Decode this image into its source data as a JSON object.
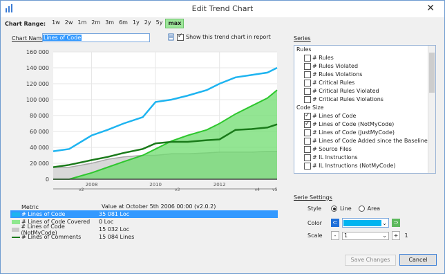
{
  "window": {
    "title": "Edit Trend Chart",
    "close_glyph": "✕"
  },
  "range": {
    "label": "Chart Range:",
    "options": [
      "1w",
      "2w",
      "1m",
      "2m",
      "3m",
      "6m",
      "1y",
      "2y",
      "5y",
      "max"
    ],
    "selected": "max"
  },
  "chart_name": {
    "label": "Chart Name",
    "value": "Lines of Code"
  },
  "show_in_report": {
    "label": "Show this trend chart in report",
    "checked": true
  },
  "chart_data": {
    "type": "area",
    "ylim": [
      0,
      160000
    ],
    "yticks": [
      "0",
      "20 000",
      "40 000",
      "60 000",
      "80 000",
      "100 000",
      "120 000",
      "140 000",
      "160 000"
    ],
    "x": [
      2006.8,
      2007.3,
      2008,
      2008.5,
      2009,
      2009.6,
      2010,
      2010.5,
      2011,
      2011.6,
      2012,
      2012.5,
      2013,
      2013.5,
      2013.8
    ],
    "xticks": [
      "2008",
      "2010",
      "2012"
    ],
    "version_labels": [
      "v2",
      "v3",
      "v4",
      "v5"
    ],
    "series": [
      {
        "name": "# Lines of Code",
        "color": "#1eb4f0",
        "kind": "line",
        "values": [
          35081,
          38000,
          55000,
          62000,
          70000,
          78000,
          97000,
          100000,
          105000,
          112000,
          120000,
          128000,
          131000,
          134000,
          140000
        ]
      },
      {
        "name": "# Lines of Code Covered",
        "color": "#4cd34c",
        "kind": "area",
        "values": [
          0,
          0,
          8000,
          15000,
          22000,
          30000,
          38000,
          48000,
          55000,
          62000,
          70000,
          82000,
          92000,
          102000,
          112000
        ]
      },
      {
        "name": "# Lines of Code (NotMyCode)",
        "color": "#c8c8c8",
        "kind": "area",
        "values": [
          15032,
          15000,
          20000,
          25000,
          28000,
          30000,
          30000,
          32000,
          32000,
          33000,
          34000,
          34000,
          34000,
          35000,
          35000
        ]
      },
      {
        "name": "# Lines of Comments",
        "color": "#1a7a1a",
        "kind": "line",
        "values": [
          15084,
          18000,
          24000,
          28000,
          33000,
          38000,
          45000,
          47000,
          47000,
          49000,
          50000,
          62000,
          63000,
          65000,
          69000
        ]
      }
    ]
  },
  "legend": {
    "col_metric": "Metric",
    "col_value": "Value at October 5th 2006  00:00  (v2.0.2)",
    "rows": [
      {
        "name": "# Lines of Code",
        "value": "35 081 Loc",
        "color": "#1eb4f0",
        "selected": true
      },
      {
        "name": "# Lines of Code Covered",
        "value": "0 Loc",
        "color": "#8fe88f",
        "selected": false
      },
      {
        "name": "# Lines of Code (NotMyCode)",
        "value": "15 032 Loc",
        "color": "#c8c8c8",
        "selected": false
      },
      {
        "name": "# Lines of Comments",
        "value": "15 084 Lines",
        "color": "#1a7a1a",
        "selected": false
      }
    ]
  },
  "series_panel": {
    "title": "Series",
    "groups": [
      {
        "name": "Rules",
        "items": [
          {
            "label": "# Rules",
            "checked": false
          },
          {
            "label": "# Rules Violated",
            "checked": false
          },
          {
            "label": "# Rules Violations",
            "checked": false
          },
          {
            "label": "# Critical Rules",
            "checked": false
          },
          {
            "label": "# Critical Rules Violated",
            "checked": false
          },
          {
            "label": "# Critical Rules Violations",
            "checked": false
          }
        ]
      },
      {
        "name": "Code Size",
        "items": [
          {
            "label": "# Lines of Code",
            "checked": true
          },
          {
            "label": "# Lines of Code (NotMyCode)",
            "checked": true
          },
          {
            "label": "# Lines of Code (JustMyCode)",
            "checked": false
          },
          {
            "label": "# Lines of Code Added since the Baseline",
            "checked": false
          },
          {
            "label": "# Source Files",
            "checked": false
          },
          {
            "label": "# IL Instructions",
            "checked": false
          },
          {
            "label": "# IL Instructions (NotMyCode)",
            "checked": false
          }
        ]
      }
    ]
  },
  "settings": {
    "title": "Serie Settings",
    "style_label": "Style",
    "line_label": "Line",
    "area_label": "Area",
    "style": "Line",
    "color_label": "Color",
    "color_value": "#00b4f0",
    "scale_label": "Scale",
    "scale_value": "1",
    "minus": "-",
    "plus": "+",
    "scale_info": "1"
  },
  "buttons": {
    "save": "Save Changes",
    "cancel": "Cancel"
  }
}
